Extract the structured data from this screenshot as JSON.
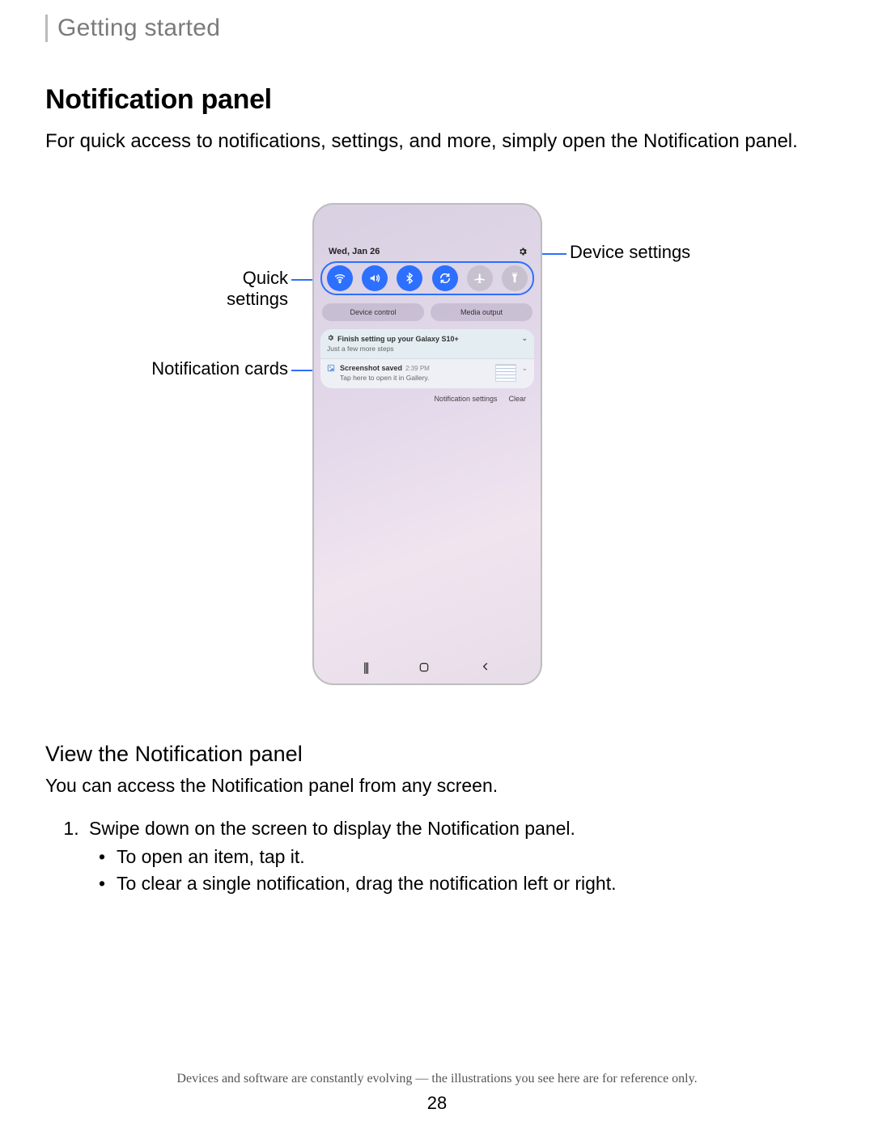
{
  "breadcrumb": "Getting started",
  "title": "Notification panel",
  "intro": "For quick access to notifications, settings, and more, simply open the Notification panel.",
  "callouts": {
    "device_settings": "Device settings",
    "quick_settings": "Quick settings",
    "notification_cards": "Notification cards"
  },
  "phone": {
    "date": "Wed, Jan 26",
    "chips": {
      "device_control": "Device control",
      "media_output": "Media output"
    },
    "notif1": {
      "title": "Finish setting up your Galaxy S10+",
      "sub": "Just a few more steps"
    },
    "notif2": {
      "title": "Screenshot saved",
      "time": "2:39 PM",
      "sub": "Tap here to open it in Gallery."
    },
    "actions": {
      "settings": "Notification settings",
      "clear": "Clear"
    },
    "nav": {
      "recent": "|||",
      "home": "▢",
      "back": "⟨"
    }
  },
  "subhead": "View the Notification panel",
  "para2": "You can access the Notification panel from any screen.",
  "step1": "Swipe down on the screen to display the Notification panel.",
  "bullet1": "To open an item, tap it.",
  "bullet2": "To clear a single notification, drag the notification left or right.",
  "footnote": "Devices and software are constantly evolving — the illustrations you see here are for reference only.",
  "pagenum": "28"
}
